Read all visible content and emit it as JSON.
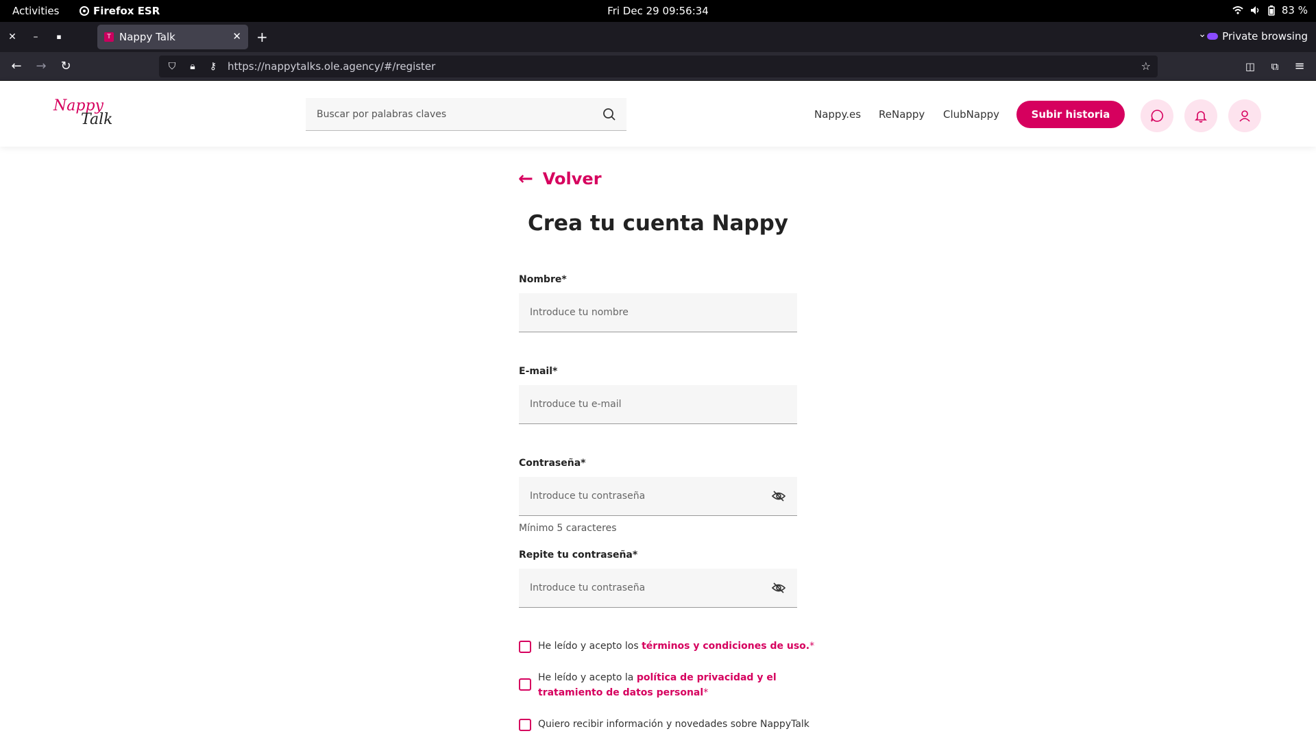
{
  "system": {
    "activities": "Activities",
    "app_name": "Firefox ESR",
    "clock": "Fri Dec 29  09:56:34",
    "battery": "83 %"
  },
  "browser": {
    "tab_title": "Nappy Talk",
    "private_label": "Private browsing",
    "url": "https://nappytalks.ole.agency/#/register"
  },
  "site": {
    "logo_line1": "Nappy",
    "logo_line2": "Talk",
    "search_placeholder": "Buscar por palabras claves",
    "nav": [
      "Nappy.es",
      "ReNappy",
      "ClubNappy"
    ],
    "cta": "Subir historia",
    "accent": "#d6005e"
  },
  "form": {
    "back": "Volver",
    "title": "Crea tu cuenta Nappy",
    "name_label": "Nombre*",
    "name_placeholder": "Introduce tu nombre",
    "email_label": "E-mail*",
    "email_placeholder": "Introduce tu e-mail",
    "password_label": "Contraseña*",
    "password_placeholder": "Introduce tu contraseña",
    "password_hint": "Mínimo 5 caracteres",
    "repeat_label": "Repite tu contraseña*",
    "repeat_placeholder": "Introduce tu contraseña",
    "terms_prefix": "He leído y acepto los ",
    "terms_link": "términos y condiciones de uso.",
    "terms_req": "*",
    "privacy_prefix": "He leído y acepto la ",
    "privacy_link": "política de privacidad y el tratamiento de datos personal",
    "privacy_req": "*",
    "newsletter": "Quiero recibir información y novedades sobre NappyTalk"
  }
}
